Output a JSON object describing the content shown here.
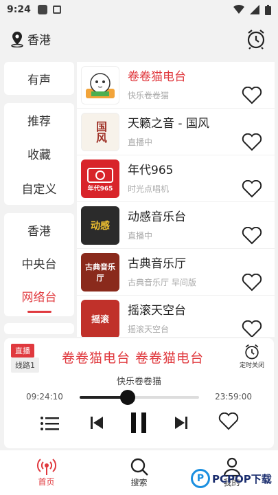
{
  "status": {
    "time": "9:24"
  },
  "header": {
    "location": "香港"
  },
  "sidebar": {
    "group1": [
      "有声"
    ],
    "group2": [
      "推荐",
      "收藏",
      "自定义"
    ],
    "group3": [
      "香港",
      "中央台",
      "网络台"
    ]
  },
  "stations": [
    {
      "name": "卷卷猫电台",
      "sub": "快乐卷卷猫",
      "active": true,
      "color": "#ffffff",
      "logo_text": "卷卷猫"
    },
    {
      "name": "天籁之音 - 国风",
      "sub": "直播中",
      "active": false,
      "color": "#f7f2ea",
      "logo_text": "国风"
    },
    {
      "name": "年代965",
      "sub": "时光点唱机",
      "active": false,
      "color": "#d8242a",
      "logo_text": "年代965"
    },
    {
      "name": "动感音乐台",
      "sub": "直播中",
      "active": false,
      "color": "#2b2b2b",
      "logo_text": "动感"
    },
    {
      "name": "古典音乐厅",
      "sub": "古典音乐厅 早间版",
      "active": false,
      "color": "#8a2a1c",
      "logo_text": "古典音乐厅"
    },
    {
      "name": "摇滚天空台",
      "sub": "摇滚天空台",
      "active": false,
      "color": "#c0312a",
      "logo_text": "摇滚"
    }
  ],
  "player": {
    "badge_live": "直播",
    "badge_line": "线路1",
    "marquee": "卷卷猫电台    卷卷猫电台",
    "timer_label": "定时关闭",
    "subtitle": "快乐卷卷猫",
    "time_start": "09:24:10",
    "time_end": "23:59:00",
    "progress": 0.4
  },
  "nav": {
    "home": "首页",
    "search": "搜索",
    "mine": "我的"
  },
  "watermark": {
    "text": "PCPOP下载",
    "o": "P"
  },
  "colors": {
    "accent": "#e0393e"
  }
}
